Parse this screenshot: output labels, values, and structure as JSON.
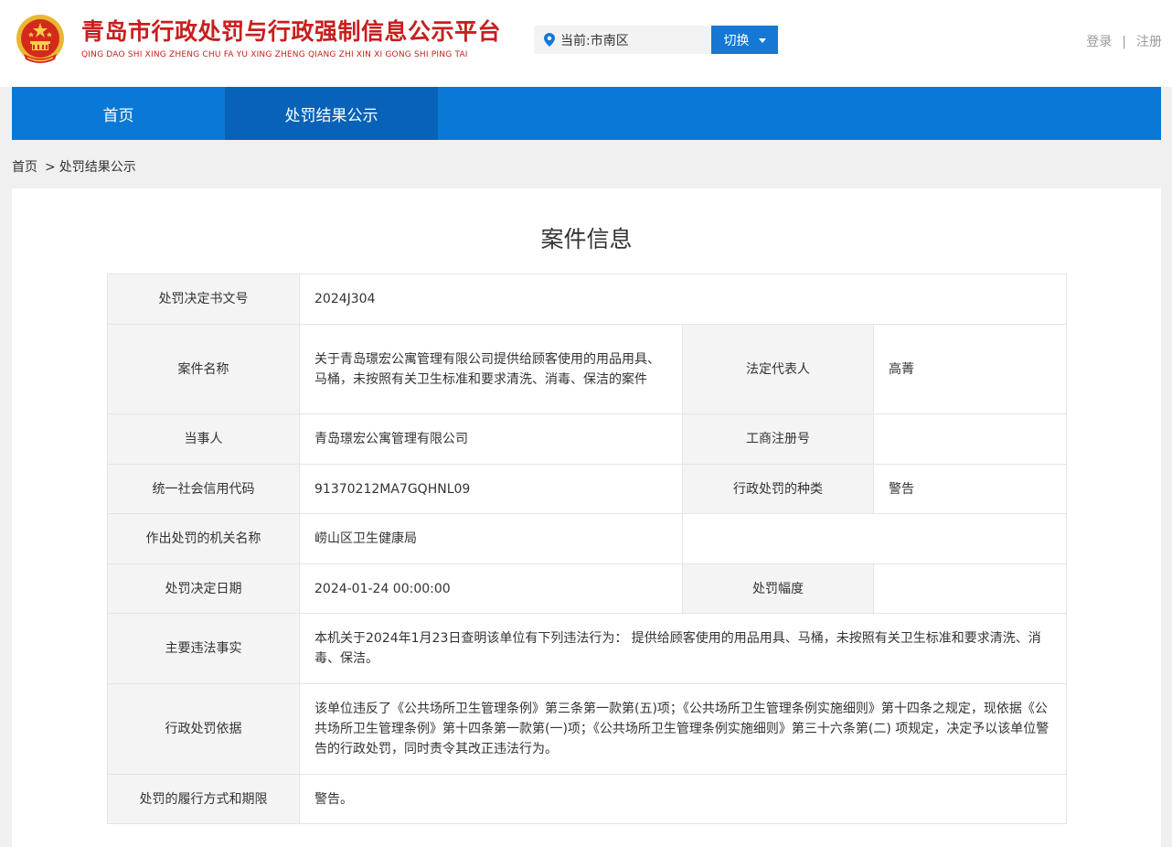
{
  "header": {
    "title": "青岛市行政处罚与行政强制信息公示平台",
    "subtitle": "QING DAO SHI XING ZHENG CHU FA YU XING ZHENG QIANG ZHI XIN XI GONG SHI PING TAI",
    "location": "当前:市南区",
    "switch_label": "切换",
    "login_label": "登录",
    "auth_separator": "|",
    "register_label": "注册"
  },
  "nav": {
    "items": [
      {
        "label": "首页"
      },
      {
        "label": "处罚结果公示"
      }
    ],
    "active_index": 1
  },
  "breadcrumb": {
    "home": "首页",
    "separator": ">",
    "current": "处罚结果公示"
  },
  "case": {
    "title": "案件信息",
    "decision_no_label": "处罚决定书文号",
    "decision_no": "2024J304",
    "case_name_label": "案件名称",
    "case_name": "关于青岛璟宏公寓管理有限公司提供给顾客使用的用品用具、马桶，未按照有关卫生标准和要求清洗、消毒、保洁的案件",
    "legal_rep_label": "法定代表人",
    "legal_rep": "高菁",
    "party_label": "当事人",
    "party": "青岛璟宏公寓管理有限公司",
    "biz_reg_label": "工商注册号",
    "biz_reg": "",
    "credit_code_label": "统一社会信用代码",
    "credit_code": "91370212MA7GQHNL09",
    "penalty_type_label": "行政处罚的种类",
    "penalty_type": "警告",
    "authority_label": "作出处罚的机关名称",
    "authority": "崂山区卫生健康局",
    "decision_date_label": "处罚决定日期",
    "decision_date": "2024-01-24 00:00:00",
    "penalty_range_label": "处罚幅度",
    "penalty_range": "",
    "facts_label": "主要违法事实",
    "facts": "本机关于2024年1月23日查明该单位有下列违法行为： 提供给顾客使用的用品用具、马桶，未按照有关卫生标准和要求清洗、消毒、保洁。",
    "basis_label": "行政处罚依据",
    "basis": "该单位违反了《公共场所卫生管理条例》第三条第一款第(五)项；《公共场所卫生管理条例实施细则》第十四条之规定，现依据《公共场所卫生管理条例》第十四条第一款第(一)项；《公共场所卫生管理条例实施细则》第三十六条第(二) 项规定，决定予以该单位警告的行政处罚，同时责令其改正违法行为。",
    "performance_label": "处罚的履行方式和期限",
    "performance": "警告。"
  },
  "colors": {
    "brand_red": "#c81e1e",
    "nav_blue": "#0a78d6",
    "nav_active": "#0862b8",
    "button_blue": "#1478d4"
  },
  "icons": {
    "emblem": "national-emblem",
    "location": "location-pin-icon",
    "switch_caret": "caret-down-icon"
  }
}
